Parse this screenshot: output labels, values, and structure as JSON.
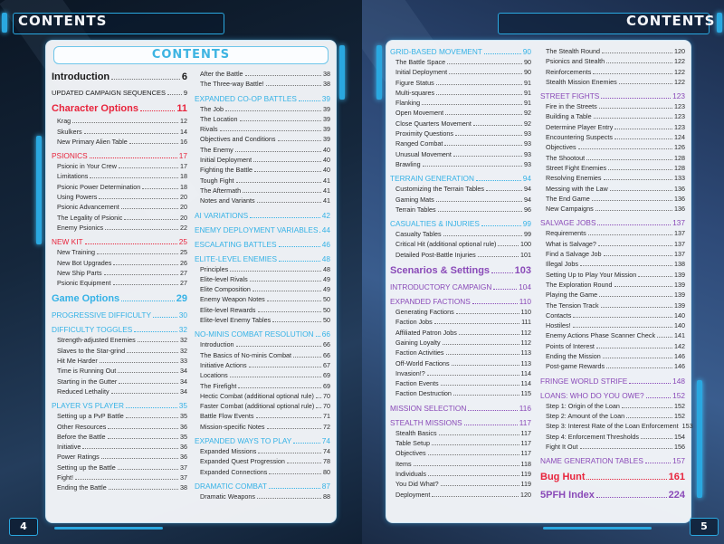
{
  "left_page": {
    "header": "CONTENTS",
    "panel_title": "CONTENTS",
    "page_number": "4",
    "columns": [
      [
        {
          "type": "major",
          "color": "black",
          "label": "Introduction",
          "page": "6"
        },
        {
          "type": "plain",
          "color": "black",
          "label": "UPDATED CAMPAIGN SEQUENCES",
          "page": "9"
        },
        {
          "type": "major",
          "color": "red",
          "label": "Character Options",
          "page": "11"
        },
        {
          "type": "sub",
          "label": "Krag",
          "page": "12"
        },
        {
          "type": "sub",
          "label": "Skulkers",
          "page": "14"
        },
        {
          "type": "sub",
          "label": "New Primary Alien Table",
          "page": "16"
        },
        {
          "type": "section",
          "color": "red",
          "label": "PSIONICS",
          "page": "17"
        },
        {
          "type": "sub",
          "label": "Psionic in Your Crew",
          "page": "17"
        },
        {
          "type": "sub",
          "label": "Limitations",
          "page": "18"
        },
        {
          "type": "sub",
          "label": "Psionic Power Determination",
          "page": "18"
        },
        {
          "type": "sub",
          "label": "Using Powers",
          "page": "20"
        },
        {
          "type": "sub",
          "label": "Psionic Advancement",
          "page": "20"
        },
        {
          "type": "sub",
          "label": "The Legality of Psionic",
          "page": "20"
        },
        {
          "type": "sub",
          "label": "Enemy Psionics",
          "page": "22"
        },
        {
          "type": "section",
          "color": "red",
          "label": "NEW KIT",
          "page": "25"
        },
        {
          "type": "sub",
          "label": "New Training",
          "page": "25"
        },
        {
          "type": "sub",
          "label": "New Bot Upgrades",
          "page": "26"
        },
        {
          "type": "sub",
          "label": "New Ship Parts",
          "page": "27"
        },
        {
          "type": "sub",
          "label": "Psionic Equipment",
          "page": "27"
        },
        {
          "type": "major",
          "color": "blue",
          "label": "Game Options",
          "page": "29"
        },
        {
          "type": "section",
          "color": "blue",
          "label": "PROGRESSIVE DIFFICULTY",
          "page": "30"
        },
        {
          "type": "section",
          "color": "blue",
          "label": "DIFFICULTY TOGGLES",
          "page": "32"
        },
        {
          "type": "sub",
          "label": "Strength-adjusted Enemies",
          "page": "32"
        },
        {
          "type": "sub",
          "label": "Slaves to the Star-grind",
          "page": "32"
        },
        {
          "type": "sub",
          "label": "Hit Me Harder",
          "page": "33"
        },
        {
          "type": "sub",
          "label": "Time is Running Out",
          "page": "34"
        },
        {
          "type": "sub",
          "label": "Starting in the Gutter",
          "page": "34"
        },
        {
          "type": "sub",
          "label": "Reduced Lethality",
          "page": "34"
        },
        {
          "type": "section",
          "color": "blue",
          "label": "PLAYER VS PLAYER",
          "page": "35"
        },
        {
          "type": "sub",
          "label": "Setting up a PvP Battle",
          "page": "35"
        },
        {
          "type": "sub",
          "label": "Other Resources",
          "page": "36"
        },
        {
          "type": "sub",
          "label": "Before the Battle",
          "page": "35"
        },
        {
          "type": "sub",
          "label": "Initiative",
          "page": "36"
        },
        {
          "type": "sub",
          "label": "Power Ratings",
          "page": "36"
        },
        {
          "type": "sub",
          "label": "Setting up the Battle",
          "page": "37"
        },
        {
          "type": "sub",
          "label": "Fight!",
          "page": "37"
        },
        {
          "type": "sub",
          "label": "Ending the Battle",
          "page": "38"
        }
      ],
      [
        {
          "type": "sub",
          "label": "After the Battle",
          "page": "38"
        },
        {
          "type": "sub",
          "label": "The Three-way Battle!",
          "page": "38"
        },
        {
          "type": "section",
          "color": "blue",
          "label": "EXPANDED CO-OP BATTLES",
          "page": "39"
        },
        {
          "type": "sub",
          "label": "The Job",
          "page": "39"
        },
        {
          "type": "sub",
          "label": "The Location",
          "page": "39"
        },
        {
          "type": "sub",
          "label": "Rivals",
          "page": "39"
        },
        {
          "type": "sub",
          "label": "Objectives and Conditions",
          "page": "39"
        },
        {
          "type": "sub",
          "label": "The Enemy",
          "page": "40"
        },
        {
          "type": "sub",
          "label": "Initial Deployment",
          "page": "40"
        },
        {
          "type": "sub",
          "label": "Fighting the Battle",
          "page": "40"
        },
        {
          "type": "sub",
          "label": "Tough Fight",
          "page": "41"
        },
        {
          "type": "sub",
          "label": "The Aftermath",
          "page": "41"
        },
        {
          "type": "sub",
          "label": "Notes and Variants",
          "page": "41"
        },
        {
          "type": "section",
          "color": "blue",
          "label": "AI VARIATIONS",
          "page": "42"
        },
        {
          "type": "section",
          "color": "blue",
          "label": "ENEMY DEPLOYMENT VARIABLES",
          "page": "44"
        },
        {
          "type": "section",
          "color": "blue",
          "label": "ESCALATING BATTLES",
          "page": "46"
        },
        {
          "type": "section",
          "color": "blue",
          "label": "ELITE-LEVEL ENEMIES",
          "page": "48"
        },
        {
          "type": "sub",
          "label": "Principles",
          "page": "48"
        },
        {
          "type": "sub",
          "label": "Elite-level Rivals",
          "page": "49"
        },
        {
          "type": "sub",
          "label": "Elite Composition",
          "page": "49"
        },
        {
          "type": "sub",
          "label": "Enemy Weapon Notes",
          "page": "50"
        },
        {
          "type": "sub",
          "label": "Elite-level Rewards",
          "page": "50"
        },
        {
          "type": "sub",
          "label": "Elite-level Enemy Tables",
          "page": "50"
        },
        {
          "type": "section",
          "color": "blue",
          "label": "NO-MINIS COMBAT RESOLUTION",
          "page": "66"
        },
        {
          "type": "sub",
          "label": "Introduction",
          "page": "66"
        },
        {
          "type": "sub",
          "label": "The Basics of No-minis Combat",
          "page": "66"
        },
        {
          "type": "sub",
          "label": "Initiative Actions",
          "page": "67"
        },
        {
          "type": "sub",
          "label": "Locations",
          "page": "69"
        },
        {
          "type": "sub",
          "label": "The Firefight",
          "page": "69"
        },
        {
          "type": "sub",
          "label": "Hectic Combat (additional optional rule)",
          "page": "70"
        },
        {
          "type": "sub",
          "label": "Faster Combat (additional optional rule)",
          "page": "70"
        },
        {
          "type": "sub",
          "label": "Battle Flow Events",
          "page": "71"
        },
        {
          "type": "sub",
          "label": "Mission-specific Notes",
          "page": "72"
        },
        {
          "type": "section",
          "color": "blue",
          "label": "EXPANDED WAYS TO PLAY",
          "page": "74"
        },
        {
          "type": "sub",
          "label": "Expanded Missions",
          "page": "74"
        },
        {
          "type": "sub",
          "label": "Expanded Quest Progression",
          "page": "78"
        },
        {
          "type": "sub",
          "label": "Expanded Connections",
          "page": "80"
        },
        {
          "type": "section",
          "color": "blue",
          "label": "DRAMATIC COMBAT",
          "page": "87"
        },
        {
          "type": "sub",
          "label": "Dramatic Weapons",
          "page": "88"
        }
      ]
    ]
  },
  "right_page": {
    "header": "CONTENTS",
    "page_number": "5",
    "columns": [
      [
        {
          "type": "section",
          "color": "blue",
          "label": "GRID-BASED MOVEMENT",
          "page": "90"
        },
        {
          "type": "sub",
          "label": "The Battle Space",
          "page": "90"
        },
        {
          "type": "sub",
          "label": "Initial Deployment",
          "page": "90"
        },
        {
          "type": "sub",
          "label": "Figure Status",
          "page": "91"
        },
        {
          "type": "sub",
          "label": "Multi-squares",
          "page": "91"
        },
        {
          "type": "sub",
          "label": "Flanking",
          "page": "91"
        },
        {
          "type": "sub",
          "label": "Open Movement",
          "page": "92"
        },
        {
          "type": "sub",
          "label": "Close Quarters Movement",
          "page": "92"
        },
        {
          "type": "sub",
          "label": "Proximity Questions",
          "page": "93"
        },
        {
          "type": "sub",
          "label": "Ranged Combat",
          "page": "93"
        },
        {
          "type": "sub",
          "label": "Unusual Movement",
          "page": "93"
        },
        {
          "type": "sub",
          "label": "Brawling",
          "page": "93"
        },
        {
          "type": "section",
          "color": "blue",
          "label": "TERRAIN GENERATION",
          "page": "94"
        },
        {
          "type": "sub",
          "label": "Customizing the Terrain Tables",
          "page": "94"
        },
        {
          "type": "sub",
          "label": "Gaming Mats",
          "page": "94"
        },
        {
          "type": "sub",
          "label": "Terrain Tables",
          "page": "96"
        },
        {
          "type": "section",
          "color": "blue",
          "label": "CASUALTIES & INJURIES",
          "page": "99"
        },
        {
          "type": "sub",
          "label": "Casualty Tables",
          "page": "99"
        },
        {
          "type": "sub",
          "label": "Critical Hit (additional optional rule)",
          "page": "100"
        },
        {
          "type": "sub",
          "label": "Detailed Post-Battle Injuries",
          "page": "101"
        },
        {
          "type": "major",
          "color": "purple",
          "label": "Scenarios & Settings",
          "page": "103"
        },
        {
          "type": "section",
          "color": "purple",
          "label": "INTRODUCTORY CAMPAIGN",
          "page": "104"
        },
        {
          "type": "section",
          "color": "purple",
          "label": "EXPANDED FACTIONS",
          "page": "110"
        },
        {
          "type": "sub",
          "label": "Generating Factions",
          "page": "110"
        },
        {
          "type": "sub",
          "label": "Faction Jobs",
          "page": "111"
        },
        {
          "type": "sub",
          "label": "Affiliated Patron Jobs",
          "page": "112"
        },
        {
          "type": "sub",
          "label": "Gaining Loyalty",
          "page": "112"
        },
        {
          "type": "sub",
          "label": "Faction Activities",
          "page": "113"
        },
        {
          "type": "sub",
          "label": "Off-World Factions",
          "page": "113"
        },
        {
          "type": "sub",
          "label": "Invasion!?",
          "page": "114"
        },
        {
          "type": "sub",
          "label": "Faction Events",
          "page": "114"
        },
        {
          "type": "sub",
          "label": "Faction Destruction",
          "page": "115"
        },
        {
          "type": "section",
          "color": "purple",
          "label": "MISSION SELECTION",
          "page": "116"
        },
        {
          "type": "section",
          "color": "purple",
          "label": "STEALTH MISSIONS",
          "page": "117"
        },
        {
          "type": "sub",
          "label": "Stealth Basics",
          "page": "117"
        },
        {
          "type": "sub",
          "label": "Table Setup",
          "page": "117"
        },
        {
          "type": "sub",
          "label": "Objectives",
          "page": "117"
        },
        {
          "type": "sub",
          "label": "Items",
          "page": "118"
        },
        {
          "type": "sub",
          "label": "Individuals",
          "page": "119"
        },
        {
          "type": "sub",
          "label": "You Did What?",
          "page": "119"
        },
        {
          "type": "sub",
          "label": "Deployment",
          "page": "120"
        }
      ],
      [
        {
          "type": "sub",
          "label": "The Stealth Round",
          "page": "120"
        },
        {
          "type": "sub",
          "label": "Psionics and Stealth",
          "page": "122"
        },
        {
          "type": "sub",
          "label": "Reinforcements",
          "page": "122"
        },
        {
          "type": "sub",
          "label": "Stealth Mission Enemies",
          "page": "122"
        },
        {
          "type": "section",
          "color": "purple",
          "label": "STREET FIGHTS",
          "page": "123"
        },
        {
          "type": "sub",
          "label": "Fire in the Streets",
          "page": "123"
        },
        {
          "type": "sub",
          "label": "Building a Table",
          "page": "123"
        },
        {
          "type": "sub",
          "label": "Determine Player Entry",
          "page": "123"
        },
        {
          "type": "sub",
          "label": "Encountering Suspects",
          "page": "124"
        },
        {
          "type": "sub",
          "label": "Objectives",
          "page": "126"
        },
        {
          "type": "sub",
          "label": "The Shootout",
          "page": "128"
        },
        {
          "type": "sub",
          "label": "Street Fight Enemies",
          "page": "128"
        },
        {
          "type": "sub",
          "label": "Resolving Enemies",
          "page": "133"
        },
        {
          "type": "sub",
          "label": "Messing with the Law",
          "page": "136"
        },
        {
          "type": "sub",
          "label": "The End Game",
          "page": "136"
        },
        {
          "type": "sub",
          "label": "New Campaigns",
          "page": "136"
        },
        {
          "type": "section",
          "color": "purple",
          "label": "SALVAGE JOBS",
          "page": "137"
        },
        {
          "type": "sub",
          "label": "Requirements",
          "page": "137"
        },
        {
          "type": "sub",
          "label": "What is Salvage?",
          "page": "137"
        },
        {
          "type": "sub",
          "label": "Find a Salvage Job",
          "page": "137"
        },
        {
          "type": "sub",
          "label": "Illegal Jobs",
          "page": "138"
        },
        {
          "type": "sub",
          "label": "Setting Up to Play Your Mission",
          "page": "139"
        },
        {
          "type": "sub",
          "label": "The Exploration Round",
          "page": "139"
        },
        {
          "type": "sub",
          "label": "Playing the Game",
          "page": "139"
        },
        {
          "type": "sub",
          "label": "The Tension Track",
          "page": "139"
        },
        {
          "type": "sub",
          "label": "Contacts",
          "page": "140"
        },
        {
          "type": "sub",
          "label": "Hostiles!",
          "page": "140"
        },
        {
          "type": "sub",
          "label": "Enemy Actions Phase Scanner Check",
          "page": "141"
        },
        {
          "type": "sub",
          "label": "Points of Interest",
          "page": "142"
        },
        {
          "type": "sub",
          "label": "Ending the Mission",
          "page": "146"
        },
        {
          "type": "sub",
          "label": "Post-game Rewards",
          "page": "146"
        },
        {
          "type": "section",
          "color": "purple",
          "label": "FRINGE WORLD STRIFE",
          "page": "148"
        },
        {
          "type": "section",
          "color": "purple",
          "label": "LOANS: WHO DO YOU OWE?",
          "page": "152"
        },
        {
          "type": "sub",
          "label": "Step 1: Origin of the Loan",
          "page": "152"
        },
        {
          "type": "sub",
          "label": "Step 2: Amount of the Loan",
          "page": "152"
        },
        {
          "type": "sub",
          "label": "Step 3: Interest Rate of the Loan Enforcement",
          "page": "153"
        },
        {
          "type": "sub",
          "label": "Step 4: Enforcement Thresholds",
          "page": "154"
        },
        {
          "type": "sub",
          "label": "Fight It Out",
          "page": "156"
        },
        {
          "type": "section",
          "color": "purple",
          "label": "NAME GENERATION TABLES",
          "page": "157"
        },
        {
          "type": "major",
          "color": "red",
          "label": "Bug Hunt",
          "page": "161"
        },
        {
          "type": "major",
          "color": "purple",
          "label": "5PFH Index",
          "page": "224"
        }
      ]
    ]
  },
  "colors": {
    "accent_cyan": "#2aa8e0",
    "section_blue": "#35b2e6",
    "section_red": "#e8243c",
    "section_purple": "#8a4ab8",
    "text_dark": "#2a2a2a"
  }
}
